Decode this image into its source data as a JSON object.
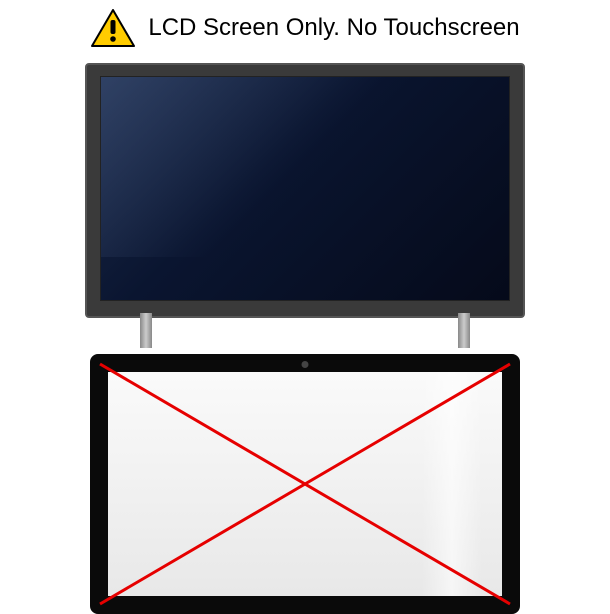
{
  "header": {
    "text": "LCD Screen Only. No Touchscreen"
  },
  "icons": {
    "warning": "warning-triangle-icon"
  },
  "colors": {
    "cross": "#e60000",
    "warning_fill": "#ffcc00",
    "warning_border": "#000000"
  }
}
